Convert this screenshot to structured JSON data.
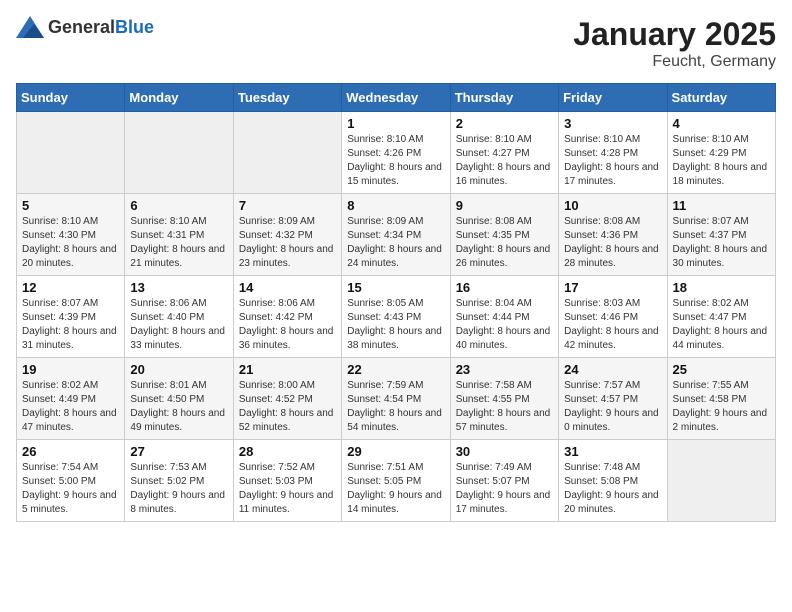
{
  "logo": {
    "general": "General",
    "blue": "Blue"
  },
  "title": "January 2025",
  "subtitle": "Feucht, Germany",
  "headers": [
    "Sunday",
    "Monday",
    "Tuesday",
    "Wednesday",
    "Thursday",
    "Friday",
    "Saturday"
  ],
  "weeks": [
    [
      {
        "day": "",
        "sunrise": "",
        "sunset": "",
        "daylight": ""
      },
      {
        "day": "",
        "sunrise": "",
        "sunset": "",
        "daylight": ""
      },
      {
        "day": "",
        "sunrise": "",
        "sunset": "",
        "daylight": ""
      },
      {
        "day": "1",
        "sunrise": "Sunrise: 8:10 AM",
        "sunset": "Sunset: 4:26 PM",
        "daylight": "Daylight: 8 hours and 15 minutes."
      },
      {
        "day": "2",
        "sunrise": "Sunrise: 8:10 AM",
        "sunset": "Sunset: 4:27 PM",
        "daylight": "Daylight: 8 hours and 16 minutes."
      },
      {
        "day": "3",
        "sunrise": "Sunrise: 8:10 AM",
        "sunset": "Sunset: 4:28 PM",
        "daylight": "Daylight: 8 hours and 17 minutes."
      },
      {
        "day": "4",
        "sunrise": "Sunrise: 8:10 AM",
        "sunset": "Sunset: 4:29 PM",
        "daylight": "Daylight: 8 hours and 18 minutes."
      }
    ],
    [
      {
        "day": "5",
        "sunrise": "Sunrise: 8:10 AM",
        "sunset": "Sunset: 4:30 PM",
        "daylight": "Daylight: 8 hours and 20 minutes."
      },
      {
        "day": "6",
        "sunrise": "Sunrise: 8:10 AM",
        "sunset": "Sunset: 4:31 PM",
        "daylight": "Daylight: 8 hours and 21 minutes."
      },
      {
        "day": "7",
        "sunrise": "Sunrise: 8:09 AM",
        "sunset": "Sunset: 4:32 PM",
        "daylight": "Daylight: 8 hours and 23 minutes."
      },
      {
        "day": "8",
        "sunrise": "Sunrise: 8:09 AM",
        "sunset": "Sunset: 4:34 PM",
        "daylight": "Daylight: 8 hours and 24 minutes."
      },
      {
        "day": "9",
        "sunrise": "Sunrise: 8:08 AM",
        "sunset": "Sunset: 4:35 PM",
        "daylight": "Daylight: 8 hours and 26 minutes."
      },
      {
        "day": "10",
        "sunrise": "Sunrise: 8:08 AM",
        "sunset": "Sunset: 4:36 PM",
        "daylight": "Daylight: 8 hours and 28 minutes."
      },
      {
        "day": "11",
        "sunrise": "Sunrise: 8:07 AM",
        "sunset": "Sunset: 4:37 PM",
        "daylight": "Daylight: 8 hours and 30 minutes."
      }
    ],
    [
      {
        "day": "12",
        "sunrise": "Sunrise: 8:07 AM",
        "sunset": "Sunset: 4:39 PM",
        "daylight": "Daylight: 8 hours and 31 minutes."
      },
      {
        "day": "13",
        "sunrise": "Sunrise: 8:06 AM",
        "sunset": "Sunset: 4:40 PM",
        "daylight": "Daylight: 8 hours and 33 minutes."
      },
      {
        "day": "14",
        "sunrise": "Sunrise: 8:06 AM",
        "sunset": "Sunset: 4:42 PM",
        "daylight": "Daylight: 8 hours and 36 minutes."
      },
      {
        "day": "15",
        "sunrise": "Sunrise: 8:05 AM",
        "sunset": "Sunset: 4:43 PM",
        "daylight": "Daylight: 8 hours and 38 minutes."
      },
      {
        "day": "16",
        "sunrise": "Sunrise: 8:04 AM",
        "sunset": "Sunset: 4:44 PM",
        "daylight": "Daylight: 8 hours and 40 minutes."
      },
      {
        "day": "17",
        "sunrise": "Sunrise: 8:03 AM",
        "sunset": "Sunset: 4:46 PM",
        "daylight": "Daylight: 8 hours and 42 minutes."
      },
      {
        "day": "18",
        "sunrise": "Sunrise: 8:02 AM",
        "sunset": "Sunset: 4:47 PM",
        "daylight": "Daylight: 8 hours and 44 minutes."
      }
    ],
    [
      {
        "day": "19",
        "sunrise": "Sunrise: 8:02 AM",
        "sunset": "Sunset: 4:49 PM",
        "daylight": "Daylight: 8 hours and 47 minutes."
      },
      {
        "day": "20",
        "sunrise": "Sunrise: 8:01 AM",
        "sunset": "Sunset: 4:50 PM",
        "daylight": "Daylight: 8 hours and 49 minutes."
      },
      {
        "day": "21",
        "sunrise": "Sunrise: 8:00 AM",
        "sunset": "Sunset: 4:52 PM",
        "daylight": "Daylight: 8 hours and 52 minutes."
      },
      {
        "day": "22",
        "sunrise": "Sunrise: 7:59 AM",
        "sunset": "Sunset: 4:54 PM",
        "daylight": "Daylight: 8 hours and 54 minutes."
      },
      {
        "day": "23",
        "sunrise": "Sunrise: 7:58 AM",
        "sunset": "Sunset: 4:55 PM",
        "daylight": "Daylight: 8 hours and 57 minutes."
      },
      {
        "day": "24",
        "sunrise": "Sunrise: 7:57 AM",
        "sunset": "Sunset: 4:57 PM",
        "daylight": "Daylight: 9 hours and 0 minutes."
      },
      {
        "day": "25",
        "sunrise": "Sunrise: 7:55 AM",
        "sunset": "Sunset: 4:58 PM",
        "daylight": "Daylight: 9 hours and 2 minutes."
      }
    ],
    [
      {
        "day": "26",
        "sunrise": "Sunrise: 7:54 AM",
        "sunset": "Sunset: 5:00 PM",
        "daylight": "Daylight: 9 hours and 5 minutes."
      },
      {
        "day": "27",
        "sunrise": "Sunrise: 7:53 AM",
        "sunset": "Sunset: 5:02 PM",
        "daylight": "Daylight: 9 hours and 8 minutes."
      },
      {
        "day": "28",
        "sunrise": "Sunrise: 7:52 AM",
        "sunset": "Sunset: 5:03 PM",
        "daylight": "Daylight: 9 hours and 11 minutes."
      },
      {
        "day": "29",
        "sunrise": "Sunrise: 7:51 AM",
        "sunset": "Sunset: 5:05 PM",
        "daylight": "Daylight: 9 hours and 14 minutes."
      },
      {
        "day": "30",
        "sunrise": "Sunrise: 7:49 AM",
        "sunset": "Sunset: 5:07 PM",
        "daylight": "Daylight: 9 hours and 17 minutes."
      },
      {
        "day": "31",
        "sunrise": "Sunrise: 7:48 AM",
        "sunset": "Sunset: 5:08 PM",
        "daylight": "Daylight: 9 hours and 20 minutes."
      },
      {
        "day": "",
        "sunrise": "",
        "sunset": "",
        "daylight": ""
      }
    ]
  ]
}
